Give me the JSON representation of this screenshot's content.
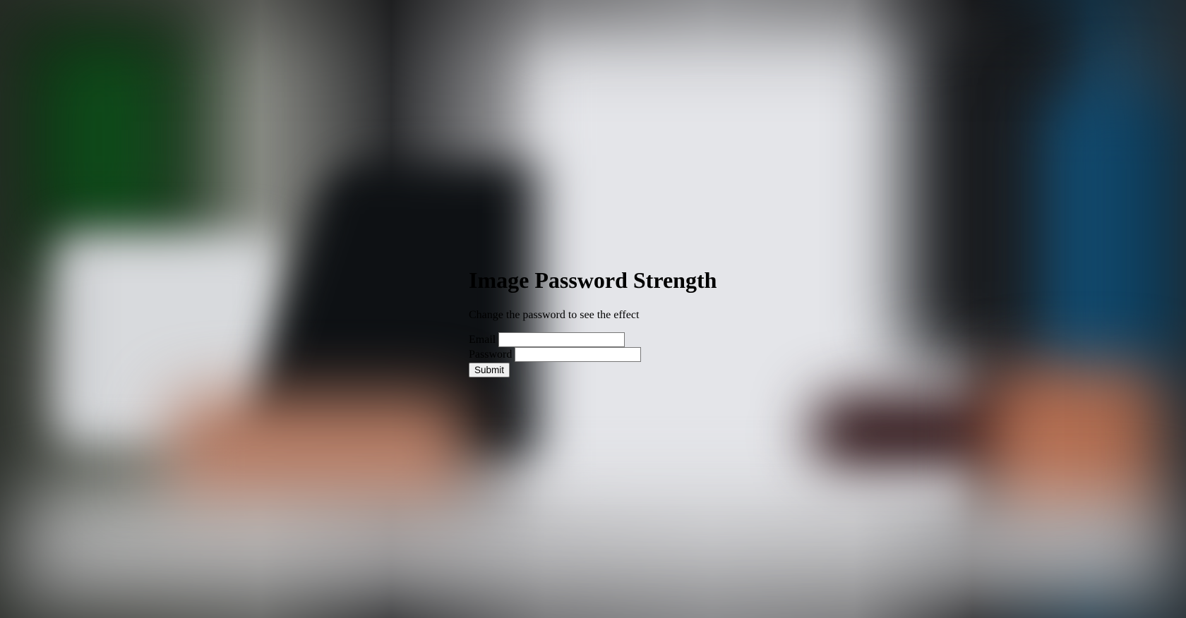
{
  "page": {
    "title": "Image Password Strength",
    "subtitle": "Change the password to see the effect"
  },
  "form": {
    "email_label": "Email",
    "email_value": "",
    "password_label": "Password",
    "password_value": "",
    "submit_label": "Submit"
  },
  "background": {
    "description_icon": "blurred-photo-background"
  }
}
